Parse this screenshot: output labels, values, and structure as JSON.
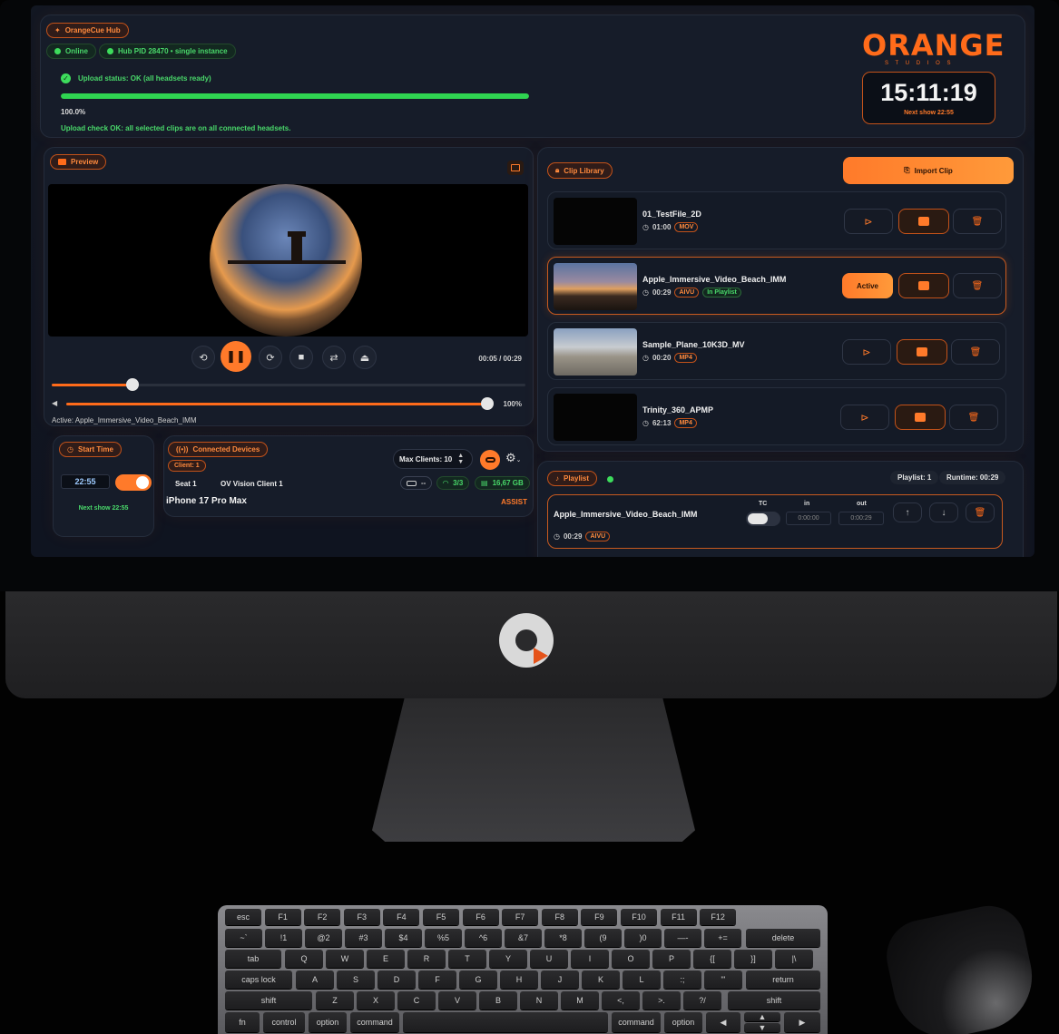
{
  "hub": {
    "title": "OrangeCue Hub",
    "status_online": "Online",
    "pid": "Hub PID 28470 • single instance",
    "upload_status": "Upload status: OK (all headsets ready)",
    "upload_progress_text": "100.0%",
    "upload_progress_value": 1.0,
    "upload_check": "Upload check OK: all selected clips are on all connected headsets."
  },
  "brand": {
    "name": "ORANGE",
    "sub": "S T U D I O S",
    "clock": "15:11:19",
    "next_show": "Next show 22:55"
  },
  "preview": {
    "title": "Preview",
    "time": "00:05 / 00:29",
    "scrub_value": 0.17,
    "volume_value": 1.0,
    "volume_text": "100%",
    "active_label": "Active: Apple_Immersive_Video_Beach_IMM"
  },
  "start_time": {
    "title": "Start Time",
    "time": "22:55",
    "next_show": "Next show 22:55"
  },
  "devices": {
    "title": "Connected Devices",
    "client_badge": "Client: 1",
    "max_clients": "Max Clients: 10",
    "seat": "Seat 1",
    "client_name": "OV Vision Client 1",
    "device": "iPhone 17 Pro Max",
    "assist": "ASSIST",
    "battery": "--",
    "wifi": "3/3",
    "storage": "16,67 GB"
  },
  "library": {
    "title": "Clip Library",
    "import": "Import Clip",
    "active_label": "Active",
    "clips": [
      {
        "name": "01_TestFile_2D",
        "duration": "01:00",
        "format": "MOV",
        "extra": ""
      },
      {
        "name": "Apple_Immersive_Video_Beach_IMM",
        "duration": "00:29",
        "format": "AIVU",
        "extra": "In Playlist"
      },
      {
        "name": "Sample_Plane_10K3D_MV",
        "duration": "00:20",
        "format": "MP4",
        "extra": ""
      },
      {
        "name": "Trinity_360_APMP",
        "duration": "62:13",
        "format": "MP4",
        "extra": ""
      }
    ]
  },
  "playlist": {
    "title": "Playlist",
    "count": "Playlist: 1",
    "runtime": "Runtime: 00:29",
    "tc_label": "TC",
    "in_label": "in",
    "out_label": "out",
    "item": {
      "name": "Apple_Immersive_Video_Beach_IMM",
      "duration": "00:29",
      "format": "AIVU",
      "in": "0:00:00",
      "out": "0:00:29"
    }
  },
  "icons": {
    "hub": "spark-icon",
    "preview": "video-icon",
    "cast": "cast-icon",
    "library": "lock-icon",
    "import": "import-icon",
    "play": "play-icon",
    "edit": "list-edit-icon",
    "delete": "trash-icon"
  },
  "colors": {
    "accent": "#ff7a2a",
    "ok": "#3ddc5c",
    "panel": "#161c29"
  },
  "keyboard": {
    "fn_row": [
      "esc",
      "F1",
      "F2",
      "F3",
      "F4",
      "F5",
      "F6",
      "F7",
      "F8",
      "F9",
      "F10",
      "F11",
      "F12"
    ],
    "row1": [
      "~`",
      "!1",
      "@2",
      "#3",
      "$4",
      "%5",
      "^6",
      "&7",
      "*8",
      "(9",
      ")0",
      "—-",
      "+="
    ],
    "delete": "delete",
    "tab": "tab",
    "row2": [
      "Q",
      "W",
      "E",
      "R",
      "T",
      "Y",
      "U",
      "I",
      "O",
      "P",
      "{[",
      "}]",
      "|\\"
    ],
    "caps": "caps lock",
    "row3": [
      "A",
      "S",
      "D",
      "F",
      "G",
      "H",
      "J",
      "K",
      "L",
      ":;",
      "\"'"
    ],
    "return": "return",
    "shift": "shift",
    "row4": [
      "Z",
      "X",
      "C",
      "V",
      "B",
      "N",
      "M",
      "<,",
      ">.",
      "?/"
    ],
    "fn": "fn",
    "control": "control",
    "option": "option",
    "command": "command"
  }
}
